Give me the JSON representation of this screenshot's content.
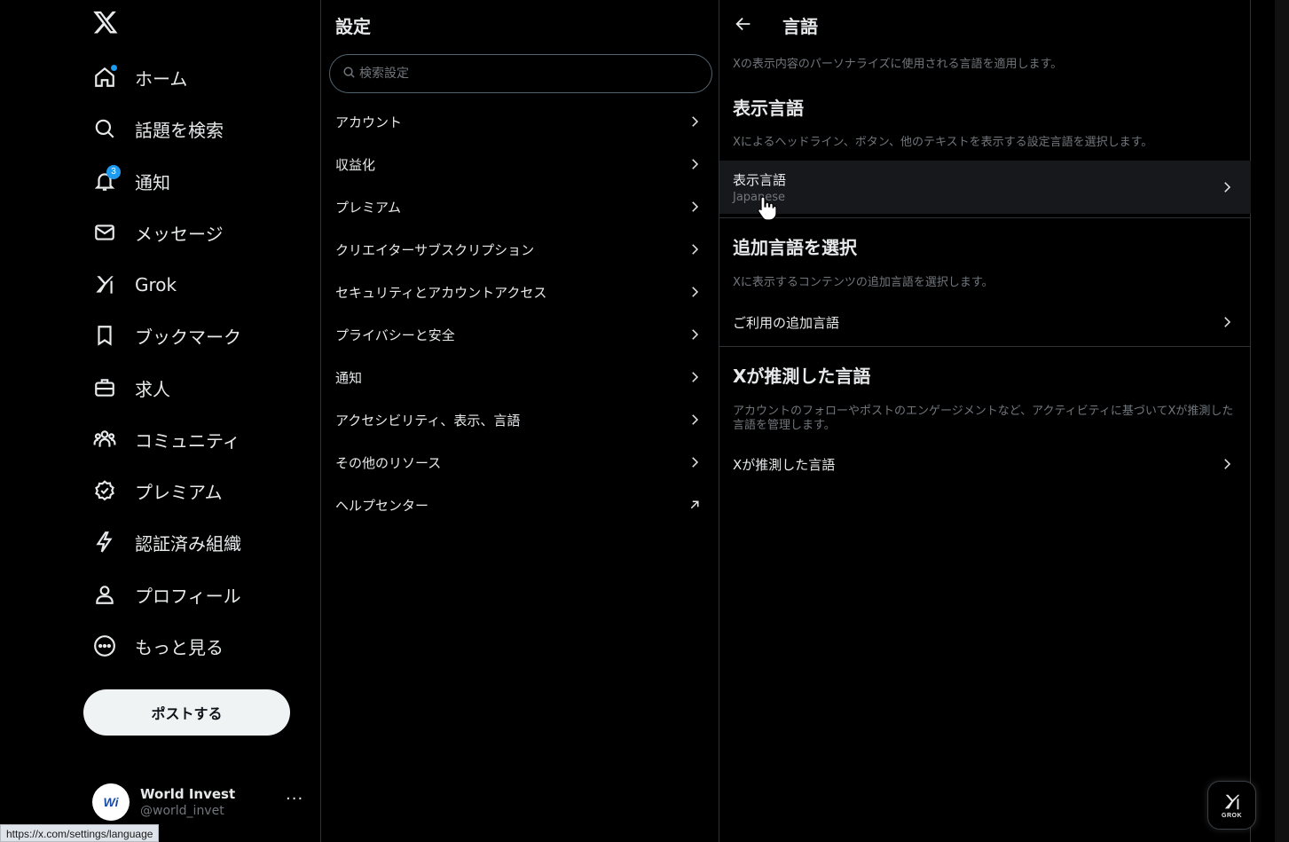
{
  "leftnav": {
    "items": [
      {
        "label": "ホーム",
        "icon": "home-icon"
      },
      {
        "label": "話題を検索",
        "icon": "search-icon"
      },
      {
        "label": "通知",
        "icon": "bell-icon",
        "badge": "3"
      },
      {
        "label": "メッセージ",
        "icon": "mail-icon"
      },
      {
        "label": "Grok",
        "icon": "grok-icon"
      },
      {
        "label": "ブックマーク",
        "icon": "bookmark-icon"
      },
      {
        "label": "求人",
        "icon": "briefcase-icon"
      },
      {
        "label": "コミュニティ",
        "icon": "people-icon"
      },
      {
        "label": "プレミアム",
        "icon": "verified-icon"
      },
      {
        "label": "認証済み組織",
        "icon": "lightning-icon"
      },
      {
        "label": "プロフィール",
        "icon": "person-icon"
      },
      {
        "label": "もっと見る",
        "icon": "more-circle-icon"
      }
    ],
    "post_button": "ポストする",
    "profile": {
      "name": "World Invest",
      "handle": "@world_invet",
      "avatar_text": "Wi"
    }
  },
  "status_url": "https://x.com/settings/language",
  "settings": {
    "title": "設定",
    "search_placeholder": "検索設定",
    "items": [
      {
        "label": "アカウント"
      },
      {
        "label": "収益化"
      },
      {
        "label": "プレミアム"
      },
      {
        "label": "クリエイターサブスクリプション"
      },
      {
        "label": "セキュリティとアカウントアクセス"
      },
      {
        "label": "プライバシーと安全"
      },
      {
        "label": "通知"
      },
      {
        "label": "アクセシビリティ、表示、言語"
      },
      {
        "label": "その他のリソース"
      },
      {
        "label": "ヘルプセンター"
      }
    ]
  },
  "language": {
    "title": "言語",
    "intro": "Xの表示内容のパーソナライズに使用される言語を適用します。",
    "display": {
      "heading": "表示言語",
      "desc": "Xによるヘッドライン、ボタン、他のテキストを表示する設定言語を選択します。",
      "row_label": "表示言語",
      "row_value": "Japanese"
    },
    "additional": {
      "heading": "追加言語を選択",
      "desc": "Xに表示するコンテンツの追加言語を選択します。",
      "row_label": "ご利用の追加言語"
    },
    "inferred": {
      "heading": "Xが推測した言語",
      "desc": "アカウントのフォローやポストのエンゲージメントなど、アクティビティに基づいてXが推測した言語を管理します。",
      "row_label": "Xが推測した言語"
    }
  },
  "grok_fab": {
    "label": "GROK"
  }
}
